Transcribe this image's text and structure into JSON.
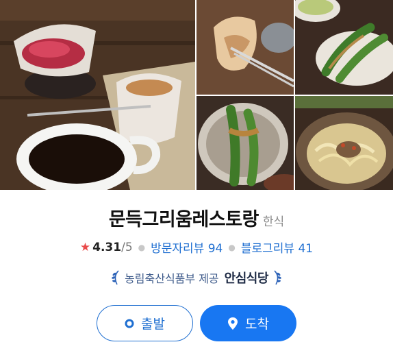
{
  "place": {
    "name": "문득그리움레스토랑",
    "category": "한식"
  },
  "rating": {
    "score": "4.31",
    "max": "/5",
    "star_color": "#e94b4b"
  },
  "reviews": {
    "visitor_label": "방문자리뷰",
    "visitor_count": "94",
    "blog_label": "블로그리뷰",
    "blog_count": "41",
    "link_color": "#1f6fd1"
  },
  "certification": {
    "provider": "농림축산식품부 제공",
    "label": "안심식당"
  },
  "actions": {
    "depart_label": "출발",
    "arrive_label": "도착",
    "primary_color": "#1877f2"
  },
  "gallery": {
    "photos": [
      "tea-and-coffee-photo",
      "fried-pancake-photo",
      "stuffed-peppers-photo",
      "peppers-closeup-photo",
      "bean-sprout-bibimbap-photo"
    ]
  }
}
